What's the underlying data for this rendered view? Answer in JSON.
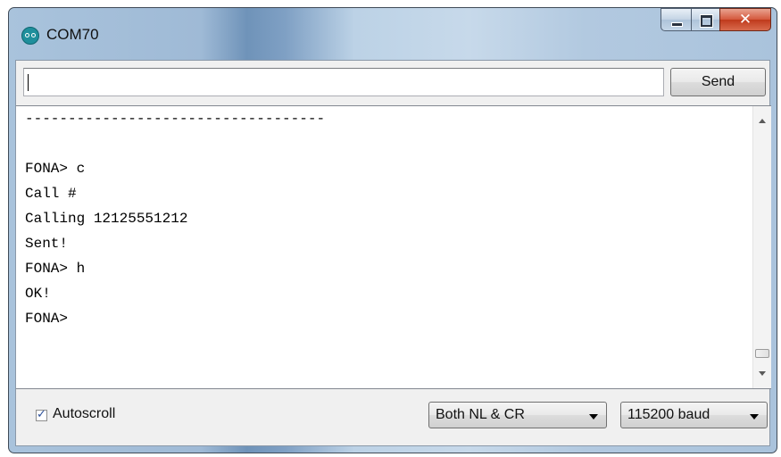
{
  "window": {
    "title": "COM70"
  },
  "input": {
    "value": ""
  },
  "toolbar": {
    "send_label": "Send"
  },
  "serial": {
    "lines": [
      "-----------------------------------",
      "",
      "FONA> c",
      "Call #",
      "Calling 12125551212",
      "Sent!",
      "FONA> h",
      "OK!",
      "FONA>"
    ]
  },
  "footer": {
    "autoscroll_label": "Autoscroll",
    "autoscroll_checked": true,
    "line_ending": "Both NL & CR",
    "baud_rate": "115200 baud"
  },
  "icons": {
    "app": "arduino-icon",
    "minimize": "minimize-icon",
    "maximize": "maximize-icon",
    "close": "close-icon",
    "check": "checkmark-icon",
    "dropdown": "chevron-down-icon"
  },
  "colors": {
    "close_button": "#c8442a",
    "app_icon": "#1f8f9c",
    "checkmark": "#2b4f9a"
  }
}
